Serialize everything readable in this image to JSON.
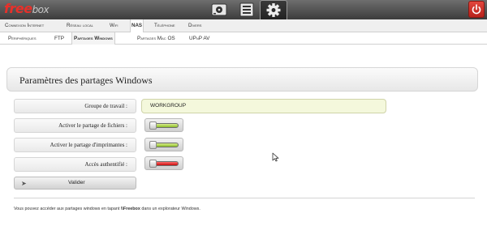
{
  "header": {
    "logo_brand": "free",
    "logo_rest": "box",
    "icons": [
      "hard-drive-icon",
      "file-list-icon",
      "gear-icon"
    ],
    "active_icon": "gear-icon",
    "power_icon": "power-icon",
    "colors": {
      "brand_red": "#e8302a",
      "bar_dark": "#3c3c3c"
    }
  },
  "menu": {
    "items": [
      "Connexion Internet",
      "Réseau local",
      "Wifi",
      "NAS",
      "Téléphone",
      "Divers"
    ],
    "active": "NAS"
  },
  "submenu": {
    "items": [
      "Périphériques",
      "FTP",
      "Partages Windows",
      "Partages Mac OS",
      "UPnP AV"
    ],
    "active": "Partages Windows"
  },
  "panel": {
    "title": "Paramètres des partages Windows"
  },
  "form": {
    "workgroup_label": "Groupe de travail :",
    "workgroup_value": "WORKGROUP",
    "file_sharing_label": "Activer le partage de fichiers :",
    "file_sharing_state": "on",
    "printer_sharing_label": "Activer le partage d'imprimantes :",
    "printer_sharing_state": "on",
    "auth_label": "Accès authentifié :",
    "auth_state": "off",
    "submit_label": "Valider",
    "colors": {
      "on": "#8cbf2a",
      "off": "#c70d0d",
      "input_bg": "#f4f8dc"
    }
  },
  "footer": {
    "note_before": "Vous pouvez accéder aux partages windows en tapant ",
    "note_bold": "\\\\Freebox",
    "note_after": " dans un explorateur Windows."
  }
}
